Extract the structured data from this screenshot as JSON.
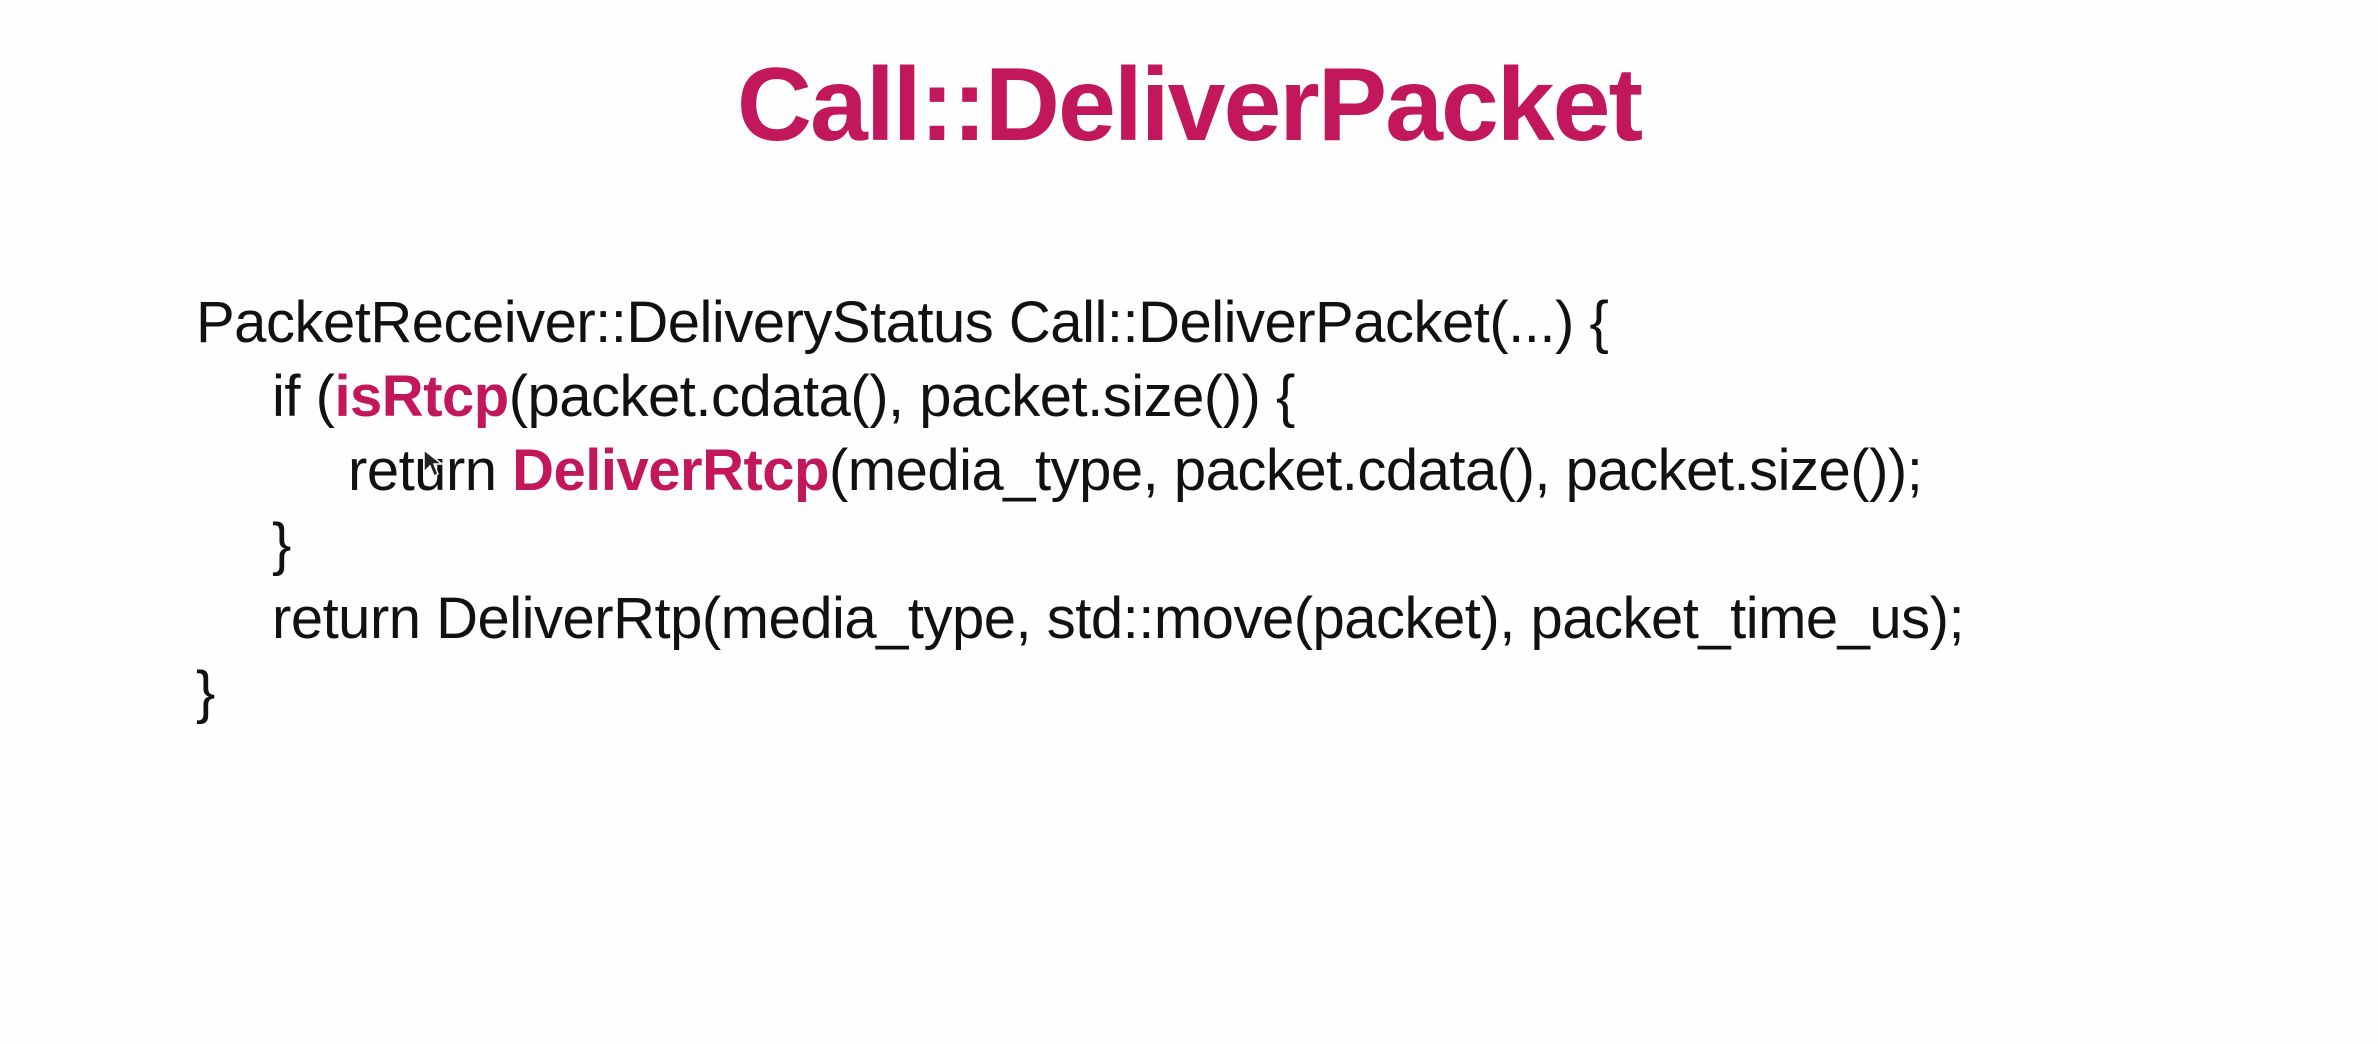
{
  "slide": {
    "title": "Call::DeliverPacket",
    "code": {
      "line1": "PacketReceiver::DeliveryStatus Call::DeliverPacket(...) {",
      "line2": {
        "prefix": "if (",
        "func": "isRtcp",
        "suffix": "(packet.cdata(), packet.size()) {"
      },
      "line3": {
        "prefix": "return ",
        "func": "DeliverRtcp",
        "suffix": "(media_type, packet.cdata(), packet.size());"
      },
      "line4": "}",
      "line5": "return DeliverRtp(media_type, std::move(packet), packet_time_us);",
      "line6": "}"
    }
  },
  "colors": {
    "accent": "#c2185b",
    "text": "#111111",
    "background": "#fefefe"
  },
  "icons": {
    "cursor": "mouse-pointer-icon"
  }
}
